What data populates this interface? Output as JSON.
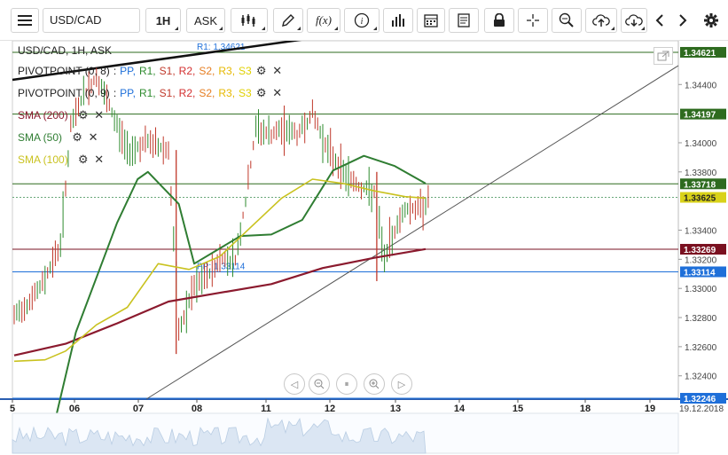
{
  "toolbar": {
    "symbol": "USD/CAD",
    "interval": "1H",
    "price_type": "ASK",
    "fx_label": "f(x)",
    "icons": [
      "menu-icon",
      "candles-icon",
      "pencil-icon",
      "function-icon",
      "info-icon",
      "bars-icon",
      "calendar-icon",
      "document-icon",
      "lock-icon",
      "crosshair-icon",
      "zoom-icon",
      "upload-cloud-icon",
      "download-cloud-icon",
      "chevron-left-icon",
      "chevron-right-icon",
      "settings-icon"
    ]
  },
  "legend": {
    "header": "USD/CAD, 1H, ASK",
    "pivot1": {
      "name": "PIVOTPOINT (0, 8)",
      "sep": ":",
      "pp": "PP,",
      "r1": "R1,",
      "s1": "S1,",
      "r2": "R2,",
      "s2": "S2,",
      "r3": "R3,",
      "s3": "S3"
    },
    "pivot2": {
      "name": "PIVOTPOINT (0, 9)",
      "sep": ":",
      "pp": "PP,",
      "r1": "R1,",
      "s1": "S1,",
      "r2": "R2,",
      "s2": "S2,",
      "r3": "R3,",
      "s3": "S3"
    },
    "sma200": "SMA (200)",
    "sma50": "SMA (50)",
    "sma100": "SMA (100)"
  },
  "colors": {
    "sma200": "#8b1a2e",
    "sma50": "#2f7d32",
    "sma100": "#c9c21f",
    "pp": "#1e6fd9",
    "r1": "#2e8b2e",
    "s1": "#c0392b",
    "r2": "#d32f2f",
    "s2": "#e67e22",
    "r3": "#e6b800",
    "s3": "#e0d000",
    "candle": "#c0392b",
    "candle_up": "#2e8b2e"
  },
  "chart_data": {
    "type": "line",
    "title": "USD/CAD, 1H, ASK",
    "xlabel": "",
    "ylabel": "",
    "ylim": [
      1.3224,
      1.347
    ],
    "x_ticks": [
      "5",
      "06",
      "07",
      "08",
      "11",
      "12",
      "13",
      "14",
      "15",
      "18",
      "19",
      "19.12.2018"
    ],
    "y_ticks": [
      "1.34400",
      "1.34000",
      "1.33800",
      "1.33400",
      "1.33200",
      "1.33000",
      "1.32800",
      "1.32600",
      "1.32400"
    ],
    "price_tags": [
      {
        "label": "1.34621",
        "value": 1.34621,
        "color": "#2e6b1f"
      },
      {
        "label": "1.34197",
        "value": 1.34197,
        "color": "#2e6b1f"
      },
      {
        "label": "1.33718",
        "value": 1.33718,
        "color": "#2e6b1f"
      },
      {
        "label": "1.33625",
        "value": 1.33625,
        "color": "#d9d21a"
      },
      {
        "label": "1.33269",
        "value": 1.33269,
        "color": "#7a1020"
      },
      {
        "label": "1.33114",
        "value": 1.33114,
        "color": "#1e6fd9"
      },
      {
        "label": "1.32246",
        "value": 1.32246,
        "color": "#1e6fd9"
      }
    ],
    "annotations": [
      {
        "text": "PP: 1.33114",
        "value": 1.33114
      },
      {
        "text": "R1: 1.34621",
        "value": 1.34621
      }
    ],
    "series": [
      {
        "name": "SMA (200)",
        "x": [
          0,
          1,
          2,
          3,
          4,
          5,
          6,
          7,
          8
        ],
        "values": [
          1.3254,
          1.3262,
          1.3276,
          1.3291,
          1.3297,
          1.3303,
          1.3314,
          1.3321,
          1.3327
        ]
      },
      {
        "name": "SMA (50)",
        "x": [
          0.8,
          1.2,
          2,
          2.4,
          2.6,
          3.2,
          3.5,
          4.4,
          5,
          5.6,
          6.2,
          6.8,
          7.4,
          8
        ],
        "values": [
          1.321,
          1.327,
          1.3345,
          1.3375,
          1.338,
          1.3358,
          1.3317,
          1.3336,
          1.3337,
          1.3347,
          1.3381,
          1.3391,
          1.3384,
          1.3372
        ]
      },
      {
        "name": "SMA (100)",
        "x": [
          0,
          0.6,
          1,
          1.6,
          2.2,
          2.8,
          3.4,
          4,
          4.6,
          5.2,
          5.8,
          6.4,
          7,
          7.6,
          8
        ],
        "values": [
          1.325,
          1.3251,
          1.3257,
          1.3275,
          1.3287,
          1.3317,
          1.3313,
          1.3322,
          1.3342,
          1.3362,
          1.3375,
          1.3372,
          1.3367,
          1.3363,
          1.3362
        ]
      }
    ]
  }
}
